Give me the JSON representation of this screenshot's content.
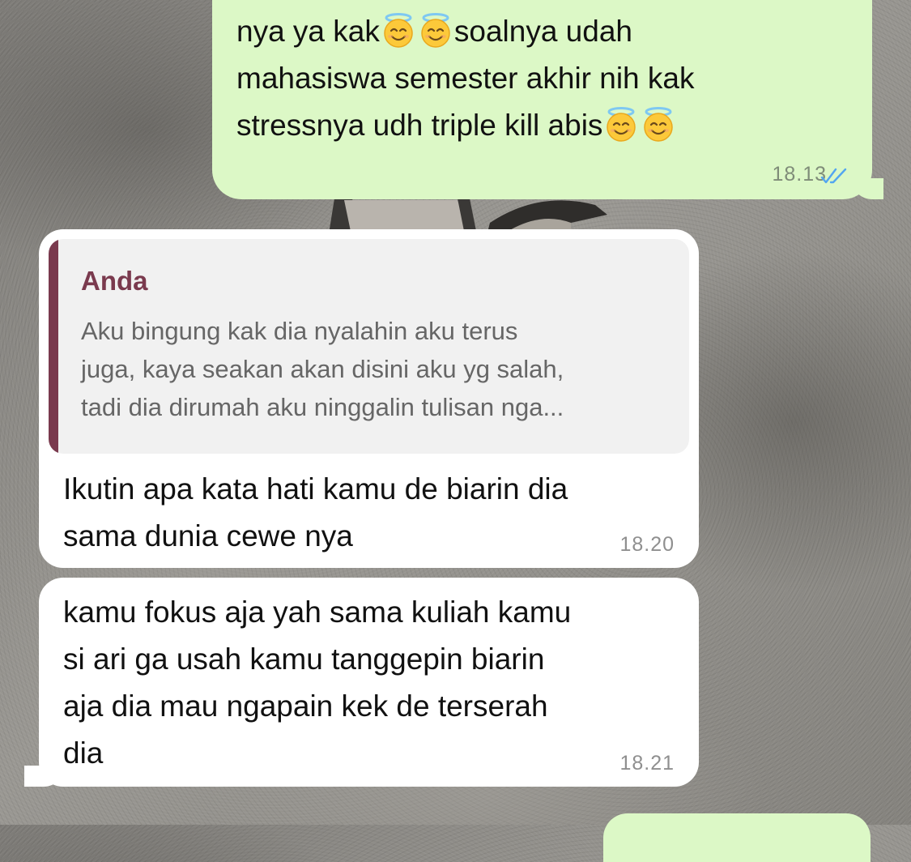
{
  "messages": [
    {
      "direction": "outgoing",
      "lines": [
        [
          "text",
          "nya ya kak"
        ],
        [
          "emoji",
          "smiling-face-with-halo"
        ],
        [
          "emoji",
          "smiling-face-with-halo"
        ],
        [
          "text",
          "soalnya udah"
        ],
        [
          "br"
        ],
        [
          "text",
          "mahasiswa semester akhir nih kak"
        ],
        [
          "br"
        ],
        [
          "text",
          "stressnya udh triple kill abis"
        ],
        [
          "emoji",
          "smiling-face-with-halo"
        ],
        [
          "emoji",
          "smiling-face-with-halo"
        ]
      ],
      "time": "18.13",
      "status_icon": "double-check-read"
    },
    {
      "direction": "incoming",
      "quote": {
        "author": "Anda",
        "text": "Aku bingung kak dia nyalahin aku terus\njuga, kaya seakan akan disini aku yg salah,\ntadi dia dirumah aku ninggalin tulisan nga..."
      },
      "text": "Ikutin apa kata hati kamu de biarin dia\nsama dunia cewe nya",
      "time": "18.20"
    },
    {
      "direction": "incoming",
      "text": "kamu fokus aja yah sama kuliah kamu\nsi ari ga usah kamu tanggepin biarin\naja dia mau ngapain kek de terserah\ndia",
      "time": "18.21"
    }
  ],
  "colors": {
    "outgoing_bubble": "#dcf8c6",
    "incoming_bubble": "#ffffff",
    "quote_accent": "#7a3a4e",
    "read_ticks": "#53a6f0"
  }
}
